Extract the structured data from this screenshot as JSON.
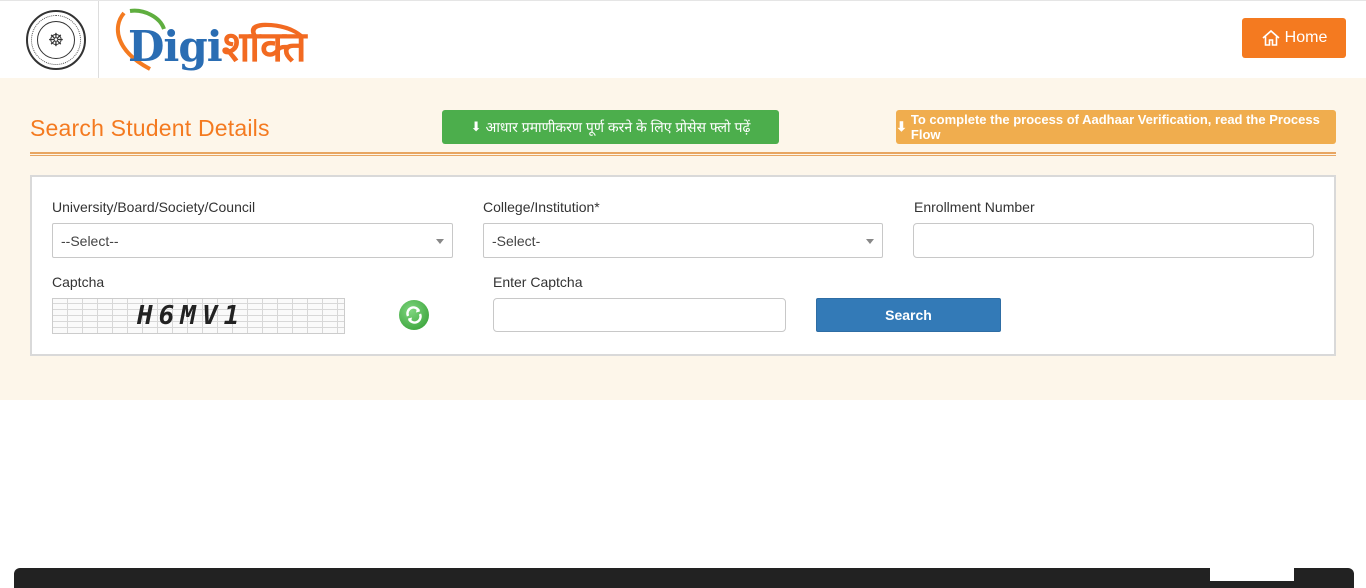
{
  "header": {
    "logo_digi": "Digi",
    "logo_shakti": "शक्ति",
    "home_label": "Home"
  },
  "page": {
    "title": "Search Student Details",
    "hindi_process_button": "आधार प्रमाणीकरण पूर्ण करने के लिए प्रोसेस फ्लो पढ़ें",
    "english_process_button": "To complete the process of Aadhaar Verification, read the Process Flow"
  },
  "form": {
    "university_label": "University/Board/Society/Council",
    "university_value": "--Select--",
    "college_label": "College/Institution*",
    "college_value": "-Select-",
    "enrollment_label": "Enrollment Number",
    "enrollment_value": "",
    "captcha_label": "Captcha",
    "captcha_text": "H6MV1",
    "enter_captcha_label": "Enter Captcha",
    "enter_captcha_value": "",
    "search_label": "Search"
  },
  "colors": {
    "accent_orange": "#f47a20",
    "green_button": "#4cae4c",
    "yellow_button": "#f0ad4e",
    "search_blue": "#337ab7",
    "band_bg": "#fdf6ea"
  }
}
